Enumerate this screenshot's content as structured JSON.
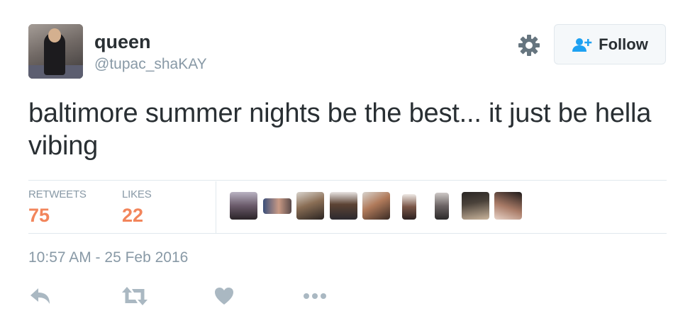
{
  "user": {
    "name": "queen",
    "handle": "@tupac_shaKAY"
  },
  "follow_button": {
    "label": "Follow"
  },
  "tweet": {
    "text": "baltimore summer nights be the best... it just be hella vibing",
    "timestamp": "10:57 AM - 25 Feb 2016"
  },
  "stats": {
    "retweets": {
      "label": "RETWEETS",
      "value": "75"
    },
    "likes": {
      "label": "LIKES",
      "value": "22"
    }
  },
  "likers": [
    {
      "icon": "liker-avatar-1"
    },
    {
      "icon": "liker-avatar-2"
    },
    {
      "icon": "liker-avatar-3"
    },
    {
      "icon": "liker-avatar-4"
    },
    {
      "icon": "liker-avatar-5"
    },
    {
      "icon": "liker-avatar-6"
    },
    {
      "icon": "liker-avatar-7"
    },
    {
      "icon": "liker-avatar-8"
    },
    {
      "icon": "liker-avatar-9"
    }
  ],
  "actions": [
    "reply-icon",
    "retweet-icon",
    "like-icon",
    "more-icon"
  ],
  "colors": {
    "accent_stat": "#f2855b",
    "secondary_text": "#8899a6",
    "icon_gray": "#aab8c2",
    "follow_icon": "#1da1f2",
    "text": "#292f33",
    "divider": "#e1e8ed"
  }
}
